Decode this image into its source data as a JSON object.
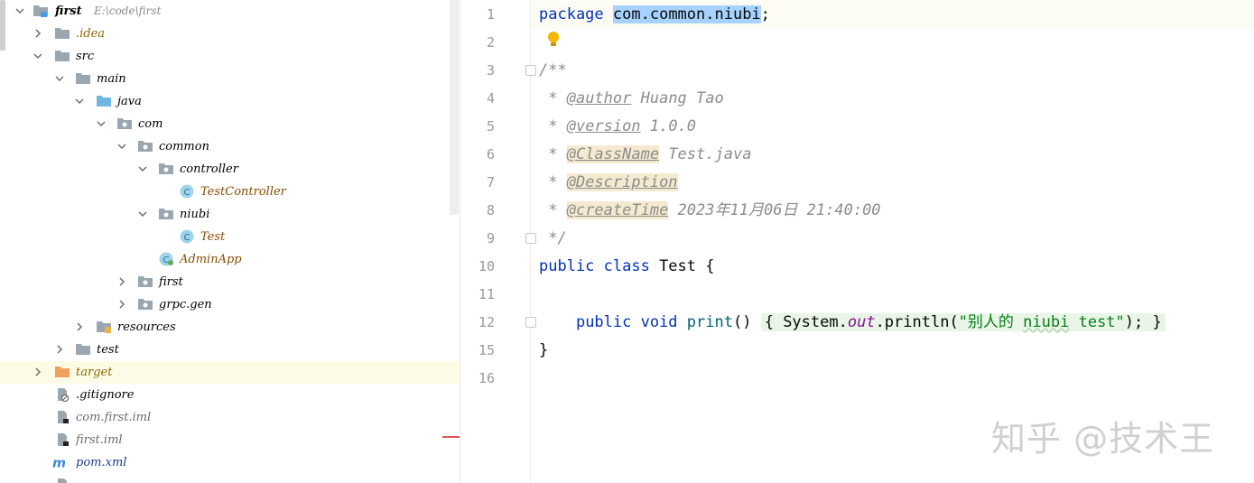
{
  "project_tree": {
    "project": {
      "name": "first",
      "path": "E:\\code\\first"
    },
    "items": [
      {
        "label": ".idea"
      },
      {
        "label": "src"
      },
      {
        "label": "main"
      },
      {
        "label": "java"
      },
      {
        "label": "com"
      },
      {
        "label": "common"
      },
      {
        "label": "controller"
      },
      {
        "label": "TestController"
      },
      {
        "label": "niubi"
      },
      {
        "label": "Test"
      },
      {
        "label": "AdminApp"
      },
      {
        "label": "first"
      },
      {
        "label": "grpc.gen"
      },
      {
        "label": "resources"
      },
      {
        "label": "test"
      },
      {
        "label": "target"
      },
      {
        "label": ".gitignore"
      },
      {
        "label": "com.first.iml"
      },
      {
        "label": "first.iml"
      },
      {
        "label": "pom.xml"
      }
    ]
  },
  "editor": {
    "line_numbers": [
      "1",
      "2",
      "3",
      "4",
      "5",
      "6",
      "7",
      "8",
      "9",
      "10",
      "11",
      "12",
      "15",
      "16"
    ],
    "lines": {
      "l1_kw": "package",
      "l1_pkg": "com.common.niubi",
      "l1_semi": ";",
      "l3": "/**",
      "l4_star": " * ",
      "l4_tag": "@author",
      "l4_val": " Huang Tao",
      "l5_star": " * ",
      "l5_tag": "@version",
      "l5_val": " 1.0.0",
      "l6_star": " * ",
      "l6_tag": "@ClassName",
      "l6_val": " Test.java",
      "l7_star": " * ",
      "l7_tag": "@Description",
      "l8_star": " * ",
      "l8_tag": "@createTime",
      "l8_val": " 2023年11月06日 21:40:00",
      "l9": " */",
      "l10_kw": "public class",
      "l10_rest": " Test {",
      "l12_indent": "    ",
      "l12_kw": "public void",
      "l12_sp": " ",
      "l12_method": "print",
      "l12_parens": "() ",
      "l12_open": "{",
      "l12_sys": " System.",
      "l12_out": "out",
      "l12_call": ".println(",
      "l12_str1": "\"别人的 ",
      "l12_str2": "niubi",
      "l12_str3": " test\"",
      "l12_end": "); ",
      "l12_close": "}",
      "l15": "}"
    }
  },
  "watermark": "知乎 @技术王",
  "colors": {
    "keyword": "#0033b3",
    "string": "#067d17",
    "comment": "#8c8c8c",
    "selection": "#a6d2ff",
    "folder": "#9aa7b0",
    "java_folder": "#6fb8e4",
    "target_folder": "#f0a05a"
  }
}
